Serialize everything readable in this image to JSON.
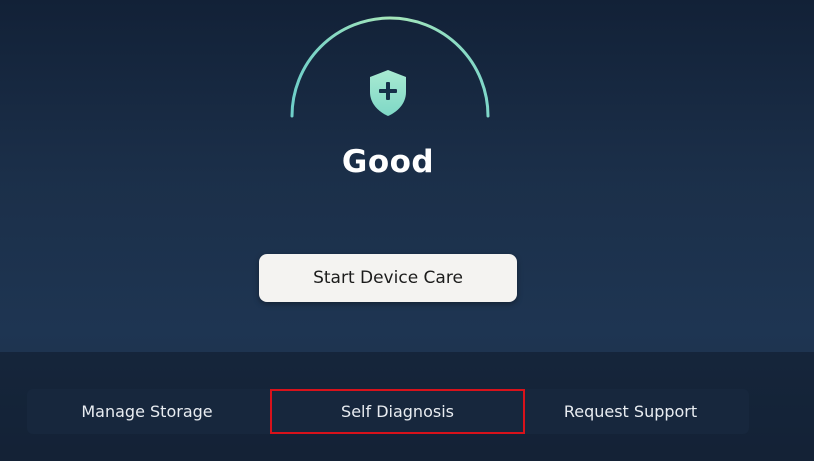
{
  "device_care": {
    "status_label": "Good",
    "status_icon": "shield-plus-icon",
    "gauge_colors": [
      "#7fd7c9",
      "#9fe3b8",
      "#7fd7c9"
    ],
    "start_button_label": "Start Device Care"
  },
  "bottom_menu": {
    "items": [
      {
        "label": "Manage Storage"
      },
      {
        "label": "Self Diagnosis"
      },
      {
        "label": "Request Support"
      }
    ],
    "focused_index": 1,
    "focus_color": "#d8121b"
  }
}
